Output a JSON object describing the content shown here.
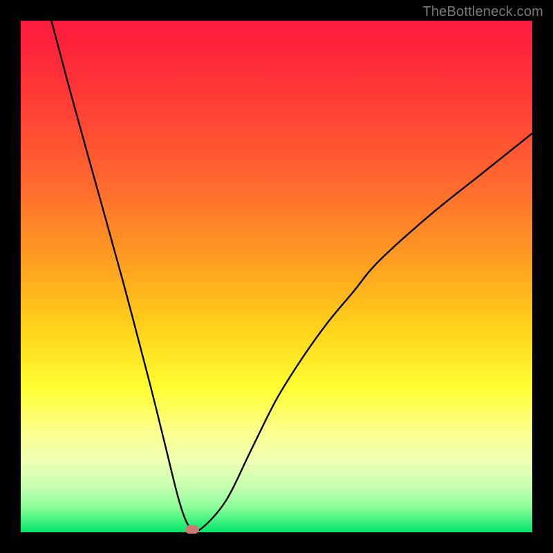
{
  "watermark": "TheBottleneck.com",
  "chart_data": {
    "type": "line",
    "title": "",
    "xlabel": "",
    "ylabel": "",
    "xlim": [
      0,
      100
    ],
    "ylim": [
      0,
      100
    ],
    "grid": false,
    "legend": false,
    "series": [
      {
        "name": "curve",
        "x": [
          6,
          10,
          15,
          20,
          25,
          28,
          31,
          33,
          35,
          40,
          45,
          50,
          55,
          60,
          65,
          70,
          80,
          90,
          100
        ],
        "y": [
          100,
          85,
          67,
          49,
          30,
          18,
          6,
          1,
          0.5,
          6,
          16,
          26,
          34,
          41,
          47,
          53,
          62,
          70,
          78
        ]
      }
    ],
    "marker": {
      "x": 33.5,
      "y": 0.5,
      "color": "#cc7a74"
    },
    "background_gradient": {
      "top": "#ff1a3c",
      "bottom": "#00e66a",
      "stops": [
        "red",
        "orange",
        "yellow",
        "green"
      ]
    }
  }
}
